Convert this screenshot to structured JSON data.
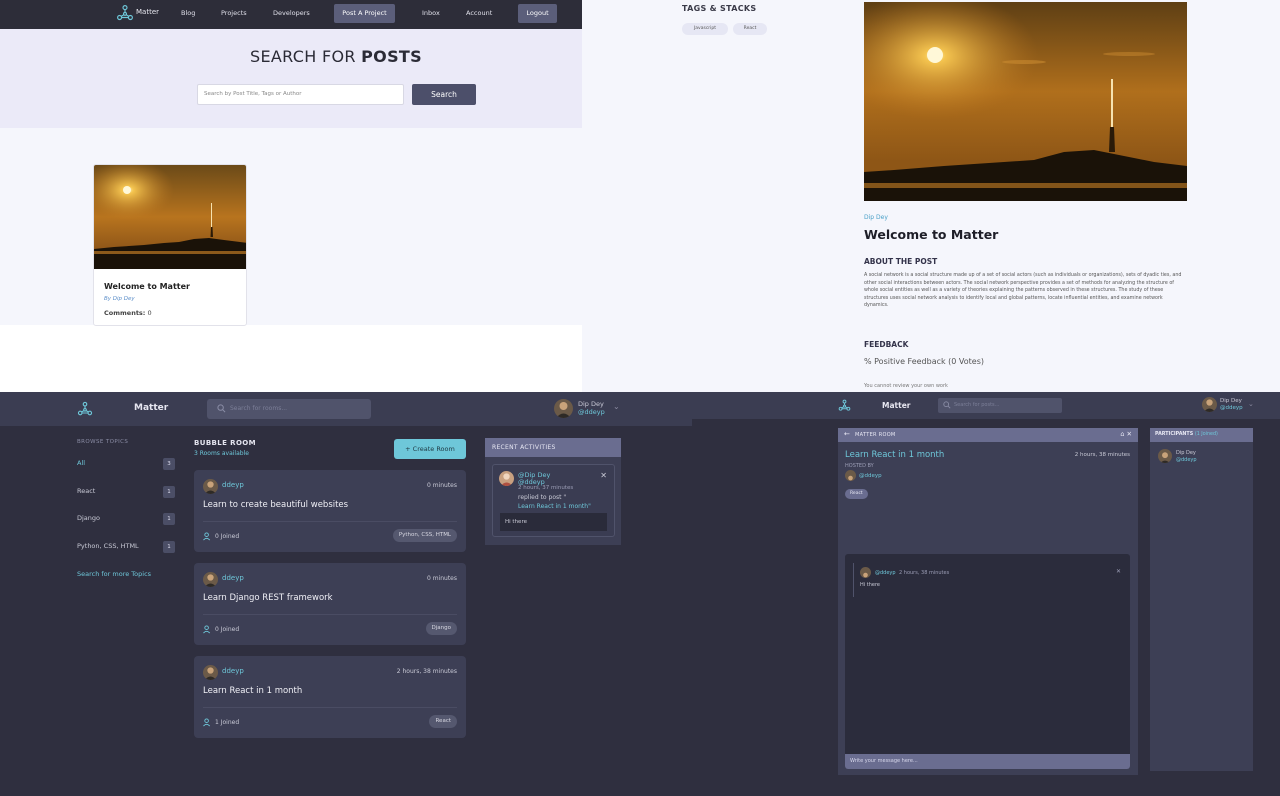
{
  "search_page": {
    "nav": {
      "brand": "Matter",
      "links": [
        "Blog",
        "Projects",
        "Developers"
      ],
      "post_project": "Post A Project",
      "inbox": "Inbox",
      "account": "Account",
      "logout": "Logout"
    },
    "hero": {
      "title_light": "SEARCH FOR ",
      "title_bold": "POSTS"
    },
    "search": {
      "placeholder": "Search by Post Title, Tags or Author",
      "button": "Search"
    },
    "card": {
      "title": "Welcome to Matter",
      "author": "By Dip Dey",
      "comments_label": "Comments:",
      "comments_count": "0"
    }
  },
  "post_page": {
    "tags_title": "TAGS & STACKS",
    "tags": [
      "Javascript",
      "React"
    ],
    "author": "Dip Dey",
    "title": "Welcome to Matter",
    "about_title": "ABOUT THE POST",
    "about_body": "A social network is a social structure made up of a set of social actors (such as individuals or organizations), sets of dyadic ties, and other social interactions between actors. The social network perspective provides a set of methods for analyzing the structure of whole social entities as well as a variety of theories explaining the patterns observed in these structures. The study of these structures uses social network analysis to identify local and global patterns, locate influential entities, and examine network dynamics.",
    "feedback_title": "FEEDBACK",
    "feedback_stat": "% Positive Feedback (0 Votes)",
    "feedback_note": "You cannot review your own work"
  },
  "rooms_page": {
    "brand": "Matter",
    "search_placeholder": "Search for rooms...",
    "user": {
      "name": "Dip Dey",
      "handle": "@ddeyp"
    },
    "browse_title": "BROWSE TOPICS",
    "topics": [
      {
        "label": "All",
        "count": "3"
      },
      {
        "label": "React",
        "count": "1"
      },
      {
        "label": "Django",
        "count": "1"
      },
      {
        "label": "Python, CSS, HTML",
        "count": "1"
      }
    ],
    "more_topics": "Search for more Topics",
    "list_title": "BUBBLE ROOM",
    "list_sub": "3 Rooms available",
    "create_button": "Create Room",
    "rooms": [
      {
        "host": "ddeyp",
        "time": "0 minutes",
        "title": "Learn to create beautiful websites",
        "joined": "0 Joined",
        "tag": "Python, CSS, HTML"
      },
      {
        "host": "ddeyp",
        "time": "0 minutes",
        "title": "Learn Django REST framework",
        "joined": "0 Joined",
        "tag": "Django"
      },
      {
        "host": "ddeyp",
        "time": "2 hours, 38 minutes",
        "title": "Learn React in 1 month",
        "joined": "1 Joined",
        "tag": "React"
      }
    ],
    "activity": {
      "title": "RECENT ACTIVITIES",
      "name": "@Dip Dey",
      "handle": "@ddeyp",
      "time": "2 hours, 37 minutes",
      "text": "replied to post \"",
      "link": "Learn React in 1 month\"",
      "message": "Hi there"
    }
  },
  "room_page": {
    "brand": "Matter",
    "search_placeholder": "Search for posts...",
    "user": {
      "name": "Dip Dey",
      "handle": "@ddeyp"
    },
    "header_title": "MATTER ROOM",
    "header_icons": "⌂  ✕",
    "title": "Learn React in 1 month",
    "time": "2 hours, 38 minutes",
    "hosted_by": "HOSTED BY",
    "host": "@ddeyp",
    "tag": "React",
    "message": {
      "handle": "@ddeyp",
      "time": "2 hours, 38 minutes",
      "text": "Hi there"
    },
    "compose_placeholder": "Write your message here...",
    "participants_title": "PARTICIPANTS ",
    "participants_count": "(1 Joined)",
    "participant": {
      "name": "Dip Dey",
      "handle": "@ddeyp"
    }
  }
}
